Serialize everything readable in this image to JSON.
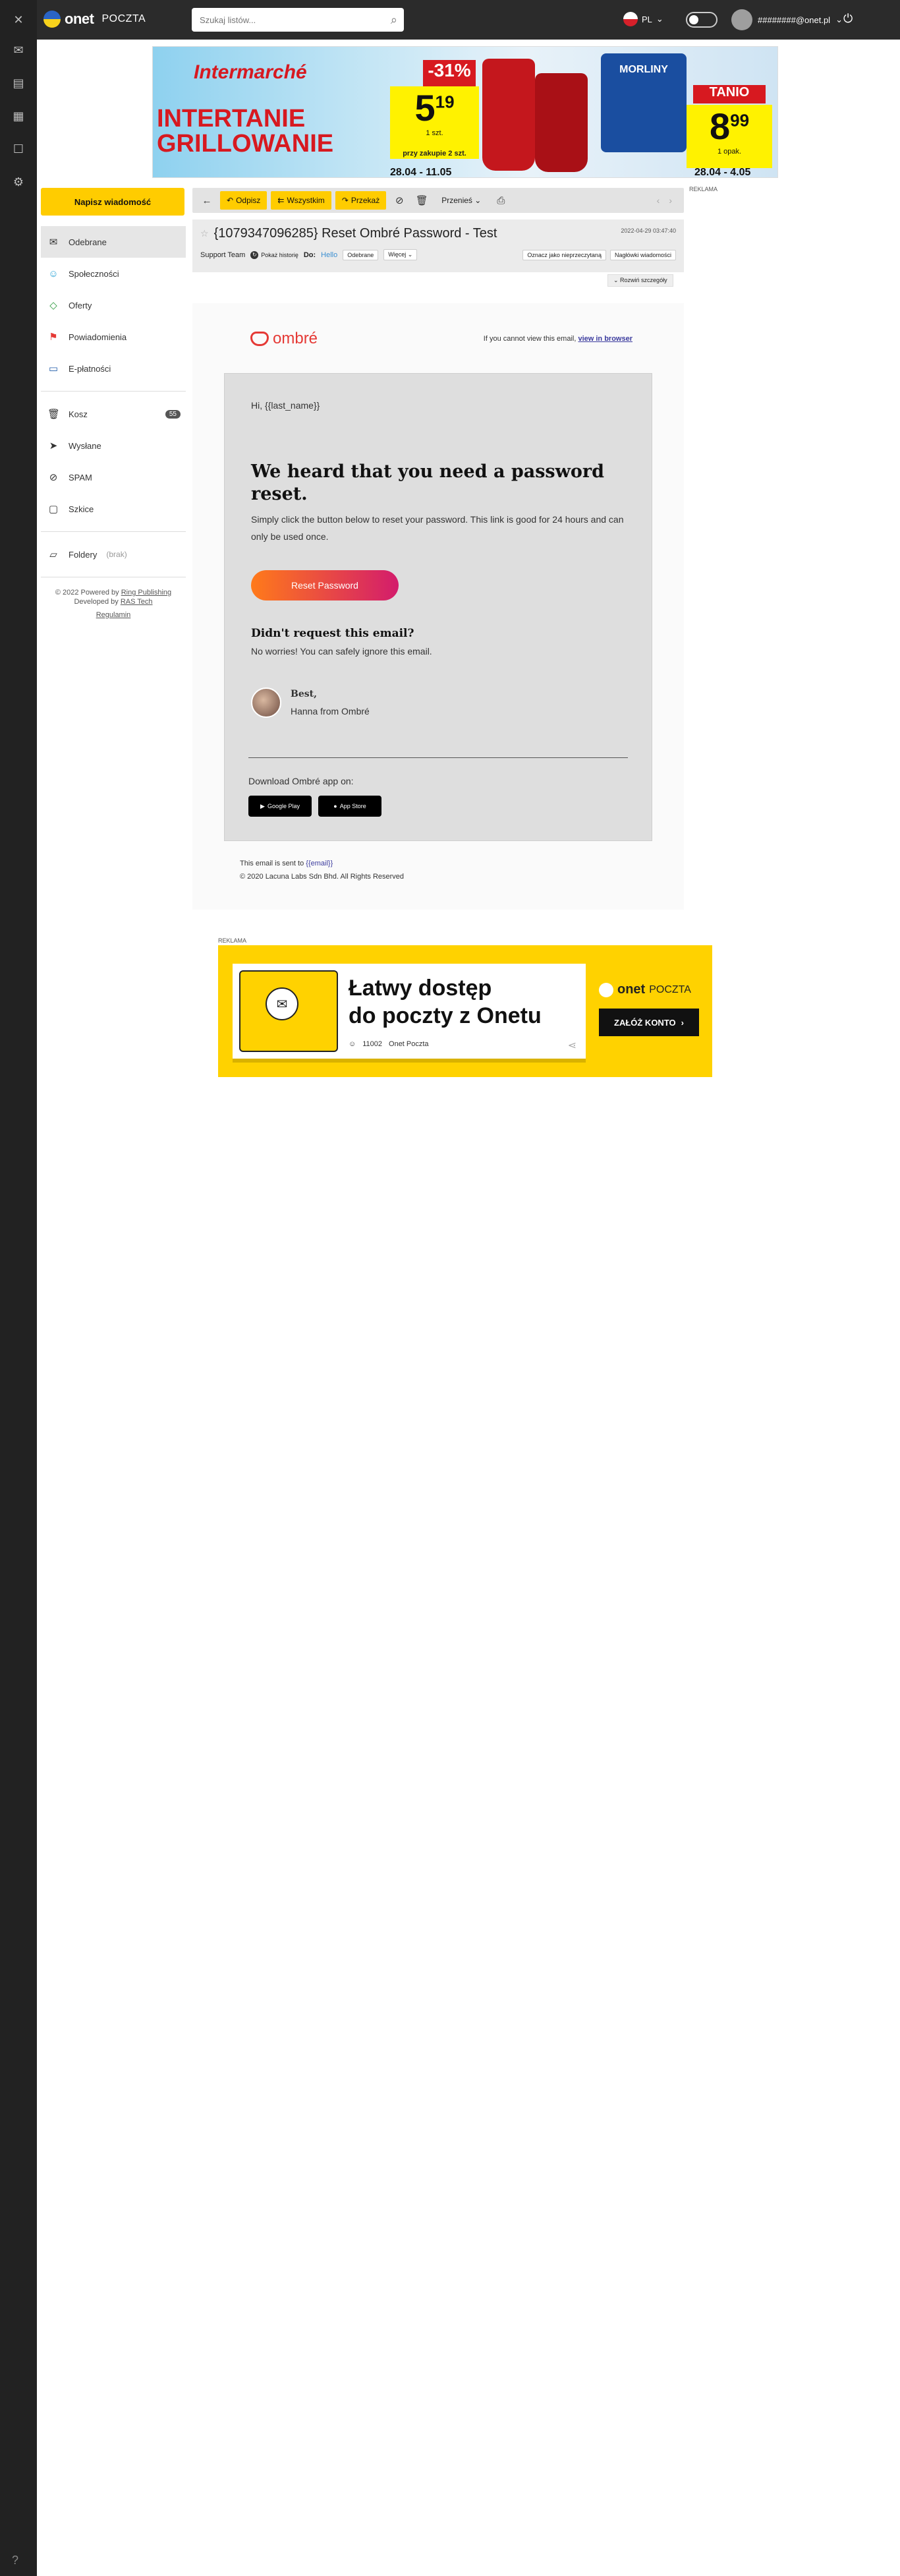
{
  "app": {
    "logo_text": "onet",
    "logo_sub": "POCZTA"
  },
  "search": {
    "placeholder": "Szukaj listów..."
  },
  "header": {
    "lang": "PL",
    "user_email": "########@onet.pl"
  },
  "top_ad": {
    "brand": "Intermarché",
    "headline_1": "INTERTANIE",
    "headline_2": "GRILLOWANIE",
    "discount": "-31%",
    "price_1": "5",
    "price_1_cents": "19",
    "price_1_unit": "1 szt.",
    "price_1_note": "przy zakupie 2 szt.",
    "date_1": "28.04 - 11.05",
    "tanio": "TANIO",
    "brand_2": "MORLINY",
    "price_2": "8",
    "price_2_cents": "99",
    "price_2_unit": "1 opak.",
    "date_2": "28.04 - 4.05",
    "ad_label": "REKLAMA"
  },
  "sidebar": {
    "compose": "Napisz wiadomość",
    "items": [
      {
        "label": "Odebrane",
        "icon": "inbox-icon"
      },
      {
        "label": "Społeczności",
        "icon": "people-icon"
      },
      {
        "label": "Oferty",
        "icon": "tag-icon"
      },
      {
        "label": "Powiadomienia",
        "icon": "flag-icon"
      },
      {
        "label": "E-płatności",
        "icon": "payments-icon"
      },
      {
        "label": "Kosz",
        "icon": "trash-icon",
        "badge": "55"
      },
      {
        "label": "Wysłane",
        "icon": "send-icon"
      },
      {
        "label": "SPAM",
        "icon": "spam-icon"
      },
      {
        "label": "Szkice",
        "icon": "drafts-icon"
      },
      {
        "label": "Foldery",
        "icon": "folder-icon",
        "hint": "(brak)"
      }
    ],
    "footer_1": "© 2022 Powered by",
    "footer_1_link": "Ring Publishing",
    "footer_2": "Developed by",
    "footer_2_link": "RAS Tech",
    "rules": "Regulamin"
  },
  "toolbar": {
    "reply": "Odpisz",
    "reply_all": "Wszystkim",
    "forward": "Przekaż",
    "move": "Przenieś"
  },
  "message": {
    "subject": "{1079347096285} Reset Ombré Password - Test",
    "date": "2022-04-29 03:47:40",
    "from": "Support Team",
    "show_history": "Pokaż historię",
    "to_label": "Do:",
    "to_value": "Hello",
    "label_inbox": "Odebrane",
    "more": "Więcej",
    "mark_unread": "Oznacz jako nieprzeczytaną",
    "headers": "Nagłówki wiadomości",
    "expand": "Rozwiń szczegóły"
  },
  "email": {
    "brand": "ombré",
    "view_prefix": "If you cannot view this email,",
    "view_link": "view in browser",
    "greeting": "Hi, {{last_name}}",
    "heading": "We heard that you need a password reset.",
    "body": "Simply click the button below to reset your password. This link is good for 24 hours and can only be used once.",
    "button": "Reset Password",
    "subheading": "Didn't request this email?",
    "subbody": "No worries! You can safely ignore this email.",
    "sign_1": "Best,",
    "sign_2": "Hanna from Ombré",
    "download": "Download Ombré app on:",
    "store_google": "Google Play",
    "store_apple": "App Store",
    "footer_prefix": "This email is sent to",
    "footer_var": "{{email}}",
    "footer_copy": "© 2020 Lacuna Labs Sdn Bhd. All Rights Reserved"
  },
  "bottom_ad": {
    "label": "REKLAMA",
    "title_1": "Łatwy dostęp",
    "title_2": "do poczty z Onetu",
    "likes": "11002",
    "source": "Onet Poczta",
    "brand": "onet",
    "brand_sub": "POCZTA",
    "cta": "ZAŁÓŻ KONTO"
  },
  "colors": {
    "accent": "#ffcc00",
    "topbar": "#2b2b2b",
    "rail": "#222222"
  }
}
